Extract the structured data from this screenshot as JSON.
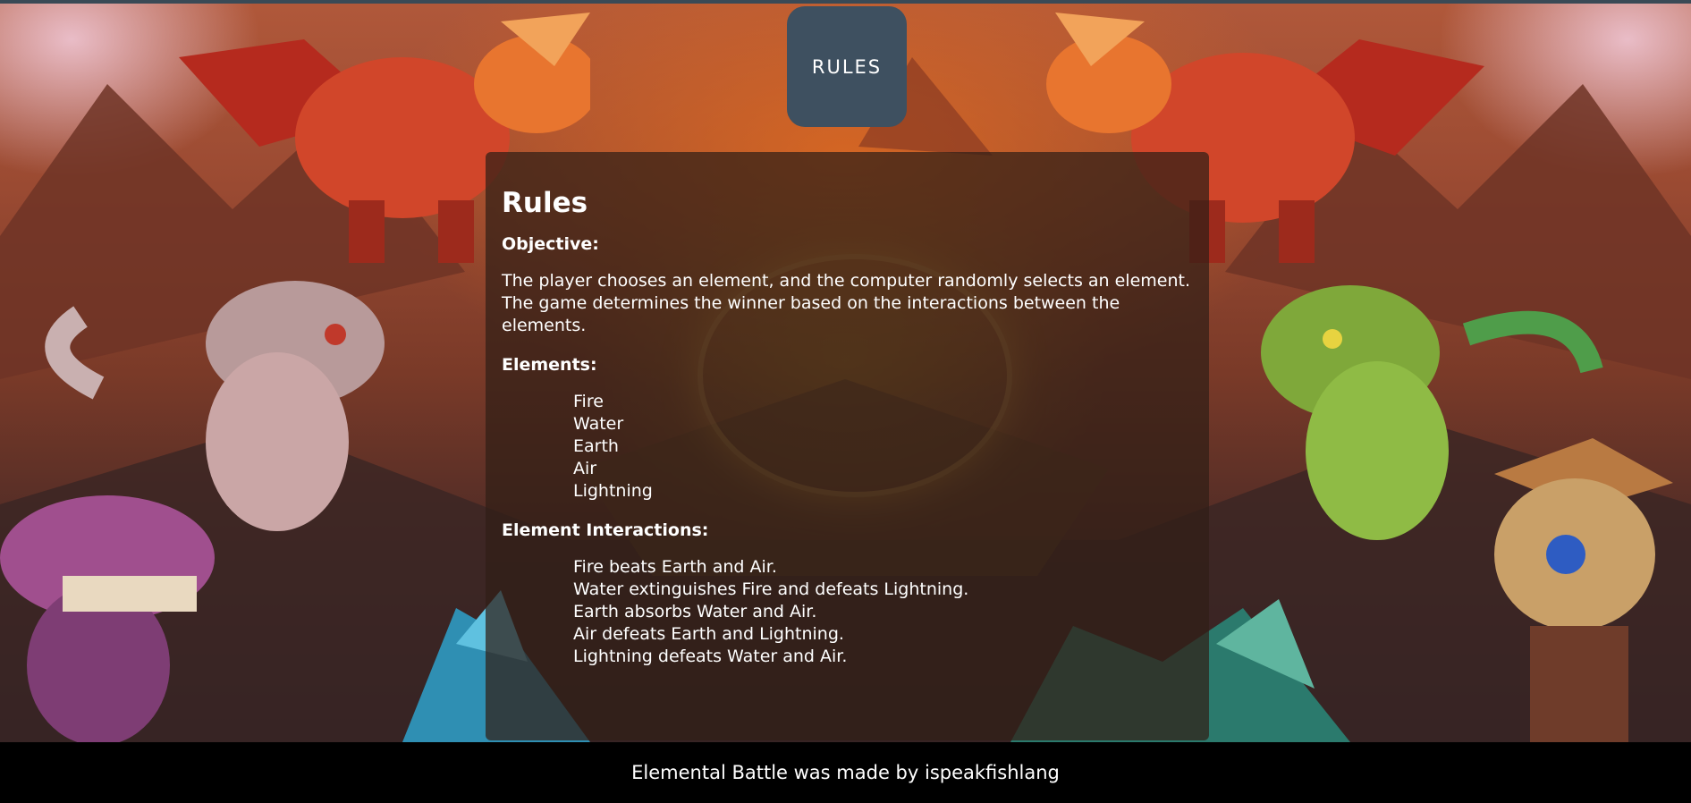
{
  "header": {
    "tab_label": "RULES"
  },
  "rules": {
    "title": "Rules",
    "objective_heading": "Objective:",
    "objective_text": "The player chooses an element, and the computer randomly selects an element. The game determines the winner based on the interactions between the elements.",
    "elements_heading": "Elements:",
    "elements": [
      "Fire",
      "Water",
      "Earth",
      "Air",
      "Lightning"
    ],
    "interactions_heading": "Element Interactions:",
    "interactions": [
      "Fire beats Earth and Air.",
      "Water extinguishes Fire and defeats Lightning.",
      "Earth absorbs Water and Air.",
      "Air defeats Earth and Lightning.",
      "Lightning defeats Water and Air."
    ]
  },
  "footer": {
    "credit": "Elemental Battle was made by ispeakfishlang"
  },
  "colors": {
    "tab_background": "#3e5060",
    "panel_background": "rgba(48,30,22,0.72)",
    "footer_background": "#000000",
    "text": "#ffffff"
  }
}
